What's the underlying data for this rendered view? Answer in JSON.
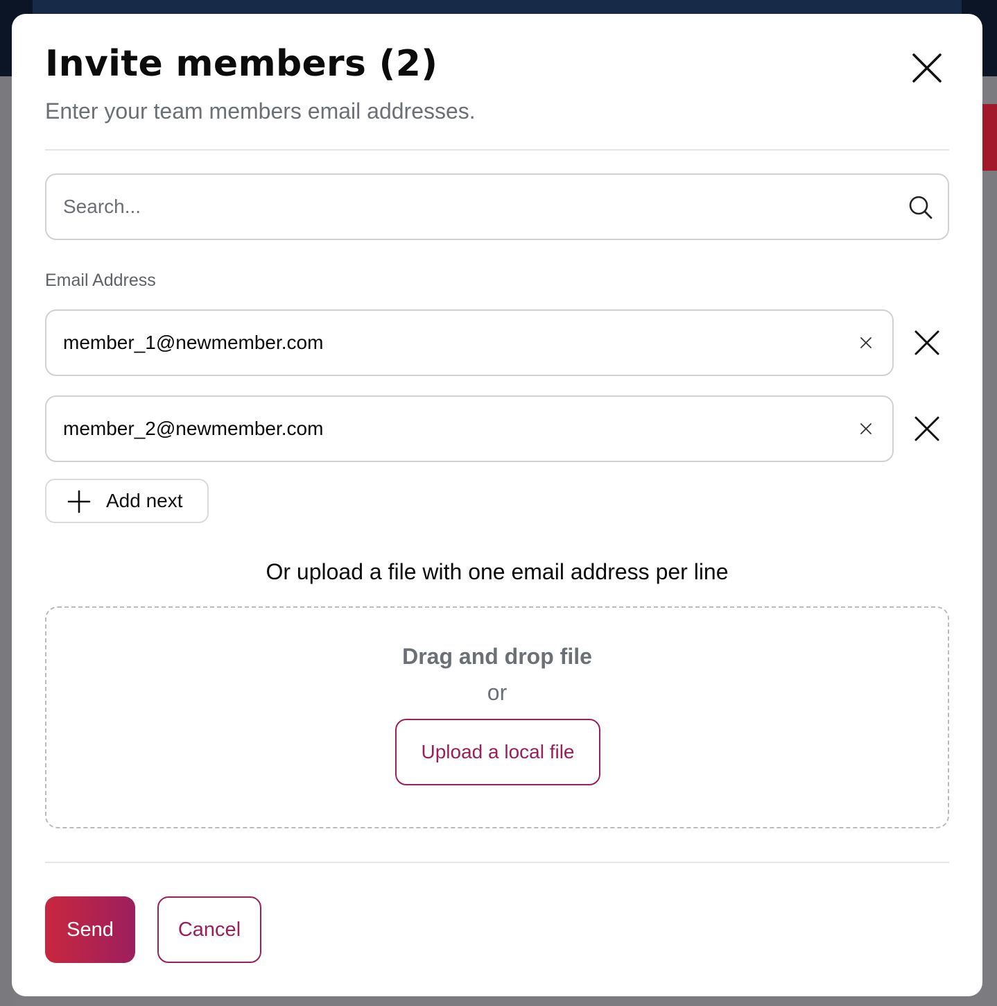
{
  "modal": {
    "title": "Invite members (2)",
    "subtitle": "Enter your team members email addresses."
  },
  "search": {
    "placeholder": "Search..."
  },
  "email_section": {
    "label": "Email Address",
    "entries": [
      {
        "value": "member_1@newmember.com"
      },
      {
        "value": "member_2@newmember.com"
      }
    ],
    "add_next_label": "Add next"
  },
  "upload": {
    "hint": "Or upload a file with one email address per line",
    "drop_title": "Drag and drop file",
    "or_text": "or",
    "button_label": "Upload a local file"
  },
  "footer": {
    "send_label": "Send",
    "cancel_label": "Cancel"
  },
  "colors": {
    "accent": "#9a1f5a",
    "send_gradient_start": "#c8273e",
    "send_gradient_end": "#9c1f5e"
  },
  "icons": [
    "close-icon",
    "search-icon",
    "clear-icon",
    "remove-icon",
    "plus-icon"
  ]
}
